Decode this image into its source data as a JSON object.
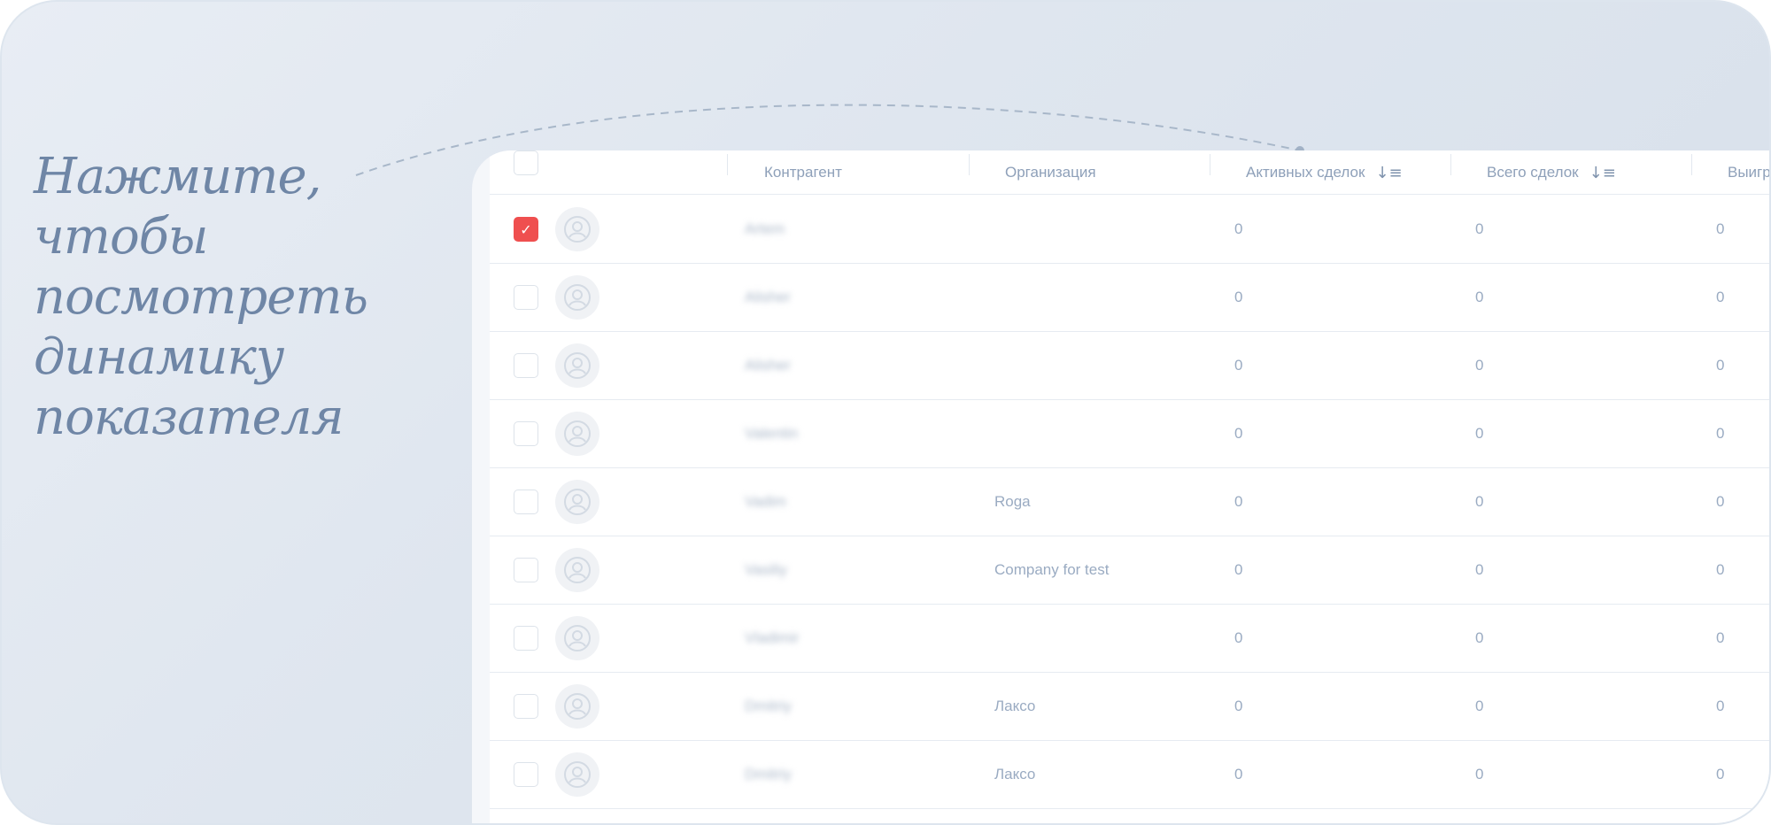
{
  "callout": {
    "lines": [
      "Нажмите, чтобы",
      "посмотреть динамику",
      "показателя"
    ]
  },
  "table": {
    "columns": {
      "contractor": "Контрагент",
      "organization": "Организация",
      "active_deals": "Активных сделок",
      "total_deals": "Всего сделок",
      "won": "Выигр"
    },
    "rows": [
      {
        "name": "Artem",
        "org": "",
        "active": "0",
        "total": "0",
        "won": "0",
        "checked": true
      },
      {
        "name": "Alisher",
        "org": "",
        "active": "0",
        "total": "0",
        "won": "0",
        "checked": false
      },
      {
        "name": "Alisher",
        "org": "",
        "active": "0",
        "total": "0",
        "won": "0",
        "checked": false
      },
      {
        "name": "Valentin",
        "org": "",
        "active": "0",
        "total": "0",
        "won": "0",
        "checked": false
      },
      {
        "name": "Vadim",
        "org": "Roga",
        "active": "0",
        "total": "0",
        "won": "0",
        "checked": false
      },
      {
        "name": "Vasiliy",
        "org": "Company for test",
        "active": "0",
        "total": "0",
        "won": "0",
        "checked": false
      },
      {
        "name": "Vladimir",
        "org": "",
        "active": "0",
        "total": "0",
        "won": "0",
        "checked": false
      },
      {
        "name": "Dmitriy",
        "org": "Лаксо",
        "active": "0",
        "total": "0",
        "won": "0",
        "checked": false
      },
      {
        "name": "Dmitriy",
        "org": "Лаксо",
        "active": "0",
        "total": "0",
        "won": "0",
        "checked": false
      }
    ]
  },
  "icons": {
    "sort": "sort-descending-icon",
    "avatar": "user-placeholder-icon",
    "check": "checkmark-icon"
  },
  "colors": {
    "accent": "#ef4f4f",
    "text_muted": "#9aabc2",
    "callout": "#6f86a6"
  }
}
